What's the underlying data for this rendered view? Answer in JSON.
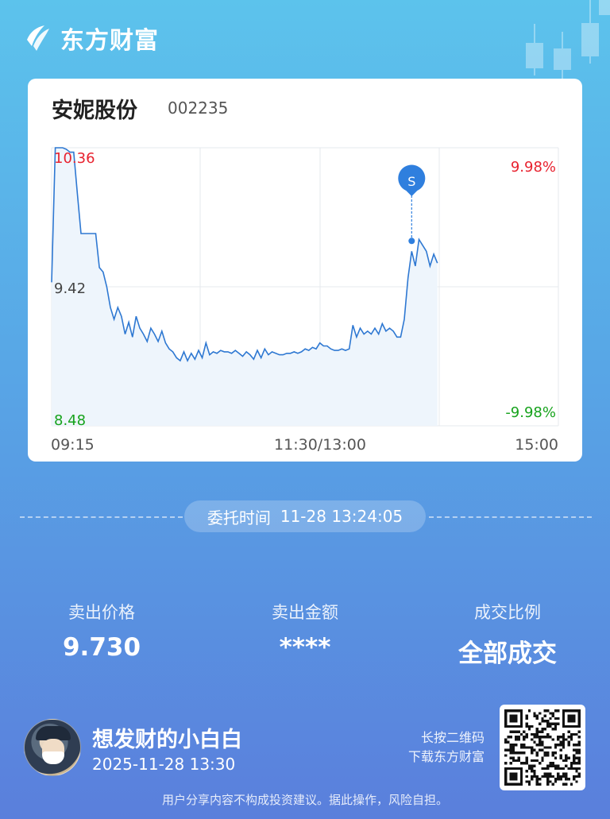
{
  "brand": {
    "name": "东方财富",
    "logo_icon": "eastmoney-logo-icon"
  },
  "stock": {
    "name": "安妮股份",
    "code": "002235"
  },
  "chart_data": {
    "type": "line",
    "y_labels": {
      "high": "10.36",
      "mid": "9.42",
      "low": "8.48"
    },
    "pct_labels": {
      "high": "9.98%",
      "low": "-9.98%"
    },
    "x_ticks": [
      "09:15",
      "11:30/13:00",
      "15:00"
    ],
    "ylim": [
      8.48,
      10.36
    ],
    "sell_marker": {
      "label": "S",
      "time_index": 98,
      "price": 9.73
    },
    "prices": [
      9.45,
      10.36,
      10.36,
      10.36,
      10.35,
      10.33,
      10.33,
      10.05,
      9.78,
      9.78,
      9.78,
      9.78,
      9.78,
      9.55,
      9.52,
      9.42,
      9.28,
      9.2,
      9.28,
      9.22,
      9.1,
      9.18,
      9.08,
      9.22,
      9.14,
      9.1,
      9.05,
      9.14,
      9.1,
      9.05,
      9.12,
      9.04,
      9.0,
      8.98,
      8.94,
      8.92,
      8.98,
      8.92,
      8.97,
      8.93,
      8.99,
      8.94,
      9.04,
      8.96,
      8.98,
      8.97,
      8.99,
      8.98,
      8.98,
      8.97,
      8.99,
      8.97,
      8.95,
      8.98,
      8.96,
      8.93,
      8.99,
      8.94,
      9.0,
      8.96,
      8.98,
      8.97,
      8.96,
      8.96,
      8.97,
      8.97,
      8.98,
      8.97,
      8.98,
      9.0,
      8.99,
      9.01,
      9.0,
      9.04,
      9.02,
      9.02,
      9.0,
      8.99,
      8.99,
      9.0,
      8.99,
      9.0,
      9.16,
      9.08,
      9.14,
      9.1,
      9.12,
      9.1,
      9.14,
      9.1,
      9.17,
      9.12,
      9.14,
      9.12,
      9.08,
      9.08,
      9.2,
      9.48,
      9.66,
      9.56,
      9.74,
      9.7,
      9.66,
      9.56,
      9.64,
      9.58
    ]
  },
  "order_time": {
    "label": "委托时间",
    "value": "11-28 13:24:05"
  },
  "stats": [
    {
      "label": "卖出价格",
      "value": "9.730"
    },
    {
      "label": "卖出金额",
      "value": "****"
    },
    {
      "label": "成交比例",
      "value": "全部成交"
    }
  ],
  "user": {
    "name": "想发财的小白白",
    "time": "2025-11-28 13:30"
  },
  "qr": {
    "line1": "长按二维码",
    "line2": "下载东方财富"
  },
  "disclaimer": "用户分享内容不构成投资建议。据此操作，风险自担。",
  "colors": {
    "up": "#e8222f",
    "down": "#17a31d",
    "line": "#2e78d2",
    "marker": "#2f7fde"
  }
}
